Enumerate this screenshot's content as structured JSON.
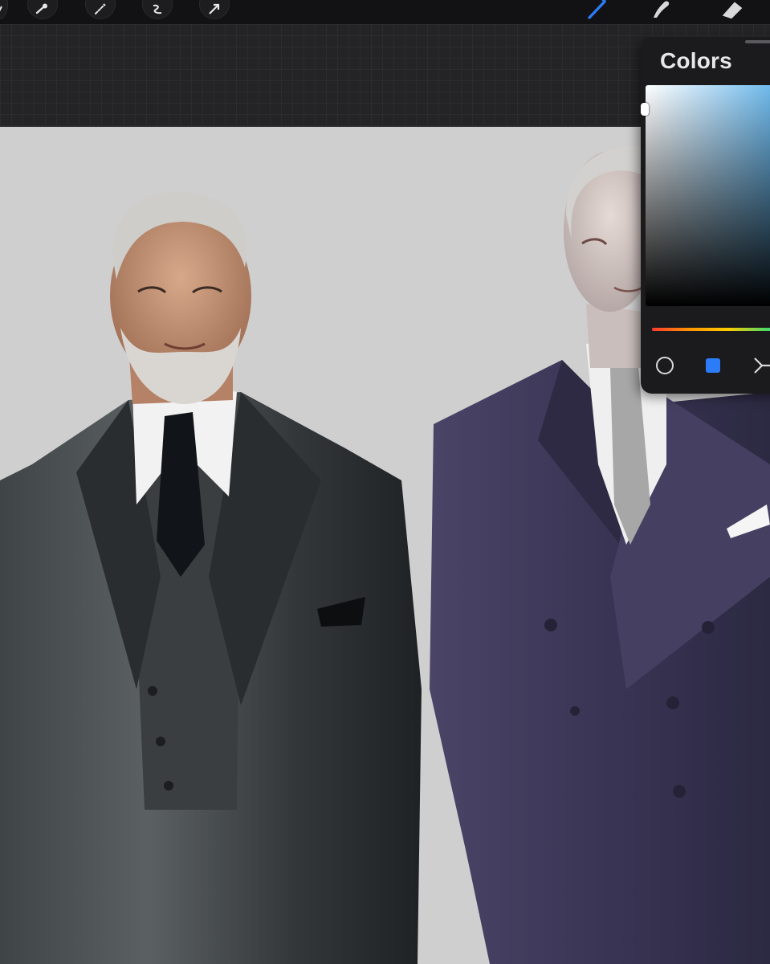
{
  "toolbar": {
    "tools": [
      {
        "icon": "adjustments-icon"
      },
      {
        "icon": "wrench-icon"
      },
      {
        "icon": "magic-wand-icon"
      },
      {
        "icon": "selection-icon"
      },
      {
        "icon": "transform-arrow-icon"
      }
    ],
    "right_tools": [
      {
        "icon": "brush-icon",
        "active": true
      },
      {
        "icon": "smudge-icon",
        "active": false
      },
      {
        "icon": "eraser-icon",
        "active": false
      }
    ],
    "accent_color": "#2b7cf6"
  },
  "colors_panel": {
    "title": "Colors",
    "current_color": "#ffffff",
    "disc_hue_color": "#47a6e6",
    "modes": [
      {
        "icon": "disc-mode-icon",
        "active": false
      },
      {
        "icon": "classic-square-mode-icon",
        "active": true
      },
      {
        "icon": "harmony-mode-icon",
        "active": false
      }
    ]
  },
  "canvas": {
    "background_color": "#cfcfd0",
    "subject": "two-men-in-suits-illustration"
  }
}
